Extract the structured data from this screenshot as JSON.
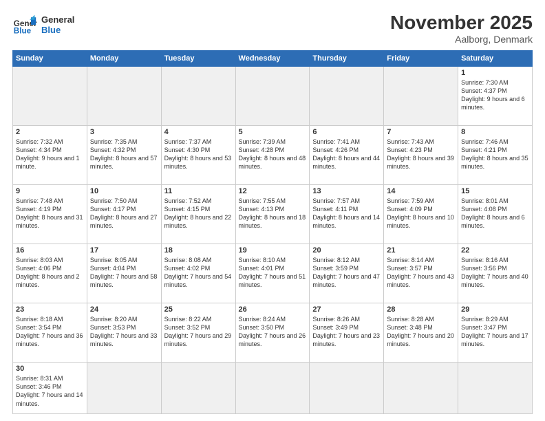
{
  "header": {
    "logo_general": "General",
    "logo_blue": "Blue",
    "title": "November 2025",
    "subtitle": "Aalborg, Denmark"
  },
  "days_of_week": [
    "Sunday",
    "Monday",
    "Tuesday",
    "Wednesday",
    "Thursday",
    "Friday",
    "Saturday"
  ],
  "weeks": [
    [
      {
        "day": "",
        "info": ""
      },
      {
        "day": "",
        "info": ""
      },
      {
        "day": "",
        "info": ""
      },
      {
        "day": "",
        "info": ""
      },
      {
        "day": "",
        "info": ""
      },
      {
        "day": "",
        "info": ""
      },
      {
        "day": "1",
        "info": "Sunrise: 7:30 AM\nSunset: 4:37 PM\nDaylight: 9 hours and 6 minutes."
      }
    ],
    [
      {
        "day": "2",
        "info": "Sunrise: 7:32 AM\nSunset: 4:34 PM\nDaylight: 9 hours and 1 minute."
      },
      {
        "day": "3",
        "info": "Sunrise: 7:35 AM\nSunset: 4:32 PM\nDaylight: 8 hours and 57 minutes."
      },
      {
        "day": "4",
        "info": "Sunrise: 7:37 AM\nSunset: 4:30 PM\nDaylight: 8 hours and 53 minutes."
      },
      {
        "day": "5",
        "info": "Sunrise: 7:39 AM\nSunset: 4:28 PM\nDaylight: 8 hours and 48 minutes."
      },
      {
        "day": "6",
        "info": "Sunrise: 7:41 AM\nSunset: 4:26 PM\nDaylight: 8 hours and 44 minutes."
      },
      {
        "day": "7",
        "info": "Sunrise: 7:43 AM\nSunset: 4:23 PM\nDaylight: 8 hours and 39 minutes."
      },
      {
        "day": "8",
        "info": "Sunrise: 7:46 AM\nSunset: 4:21 PM\nDaylight: 8 hours and 35 minutes."
      }
    ],
    [
      {
        "day": "9",
        "info": "Sunrise: 7:48 AM\nSunset: 4:19 PM\nDaylight: 8 hours and 31 minutes."
      },
      {
        "day": "10",
        "info": "Sunrise: 7:50 AM\nSunset: 4:17 PM\nDaylight: 8 hours and 27 minutes."
      },
      {
        "day": "11",
        "info": "Sunrise: 7:52 AM\nSunset: 4:15 PM\nDaylight: 8 hours and 22 minutes."
      },
      {
        "day": "12",
        "info": "Sunrise: 7:55 AM\nSunset: 4:13 PM\nDaylight: 8 hours and 18 minutes."
      },
      {
        "day": "13",
        "info": "Sunrise: 7:57 AM\nSunset: 4:11 PM\nDaylight: 8 hours and 14 minutes."
      },
      {
        "day": "14",
        "info": "Sunrise: 7:59 AM\nSunset: 4:09 PM\nDaylight: 8 hours and 10 minutes."
      },
      {
        "day": "15",
        "info": "Sunrise: 8:01 AM\nSunset: 4:08 PM\nDaylight: 8 hours and 6 minutes."
      }
    ],
    [
      {
        "day": "16",
        "info": "Sunrise: 8:03 AM\nSunset: 4:06 PM\nDaylight: 8 hours and 2 minutes."
      },
      {
        "day": "17",
        "info": "Sunrise: 8:05 AM\nSunset: 4:04 PM\nDaylight: 7 hours and 58 minutes."
      },
      {
        "day": "18",
        "info": "Sunrise: 8:08 AM\nSunset: 4:02 PM\nDaylight: 7 hours and 54 minutes."
      },
      {
        "day": "19",
        "info": "Sunrise: 8:10 AM\nSunset: 4:01 PM\nDaylight: 7 hours and 51 minutes."
      },
      {
        "day": "20",
        "info": "Sunrise: 8:12 AM\nSunset: 3:59 PM\nDaylight: 7 hours and 47 minutes."
      },
      {
        "day": "21",
        "info": "Sunrise: 8:14 AM\nSunset: 3:57 PM\nDaylight: 7 hours and 43 minutes."
      },
      {
        "day": "22",
        "info": "Sunrise: 8:16 AM\nSunset: 3:56 PM\nDaylight: 7 hours and 40 minutes."
      }
    ],
    [
      {
        "day": "23",
        "info": "Sunrise: 8:18 AM\nSunset: 3:54 PM\nDaylight: 7 hours and 36 minutes."
      },
      {
        "day": "24",
        "info": "Sunrise: 8:20 AM\nSunset: 3:53 PM\nDaylight: 7 hours and 33 minutes."
      },
      {
        "day": "25",
        "info": "Sunrise: 8:22 AM\nSunset: 3:52 PM\nDaylight: 7 hours and 29 minutes."
      },
      {
        "day": "26",
        "info": "Sunrise: 8:24 AM\nSunset: 3:50 PM\nDaylight: 7 hours and 26 minutes."
      },
      {
        "day": "27",
        "info": "Sunrise: 8:26 AM\nSunset: 3:49 PM\nDaylight: 7 hours and 23 minutes."
      },
      {
        "day": "28",
        "info": "Sunrise: 8:28 AM\nSunset: 3:48 PM\nDaylight: 7 hours and 20 minutes."
      },
      {
        "day": "29",
        "info": "Sunrise: 8:29 AM\nSunset: 3:47 PM\nDaylight: 7 hours and 17 minutes."
      }
    ],
    [
      {
        "day": "30",
        "info": "Sunrise: 8:31 AM\nSunset: 3:46 PM\nDaylight: 7 hours and 14 minutes."
      },
      {
        "day": "",
        "info": ""
      },
      {
        "day": "",
        "info": ""
      },
      {
        "day": "",
        "info": ""
      },
      {
        "day": "",
        "info": ""
      },
      {
        "day": "",
        "info": ""
      },
      {
        "day": "",
        "info": ""
      }
    ]
  ]
}
